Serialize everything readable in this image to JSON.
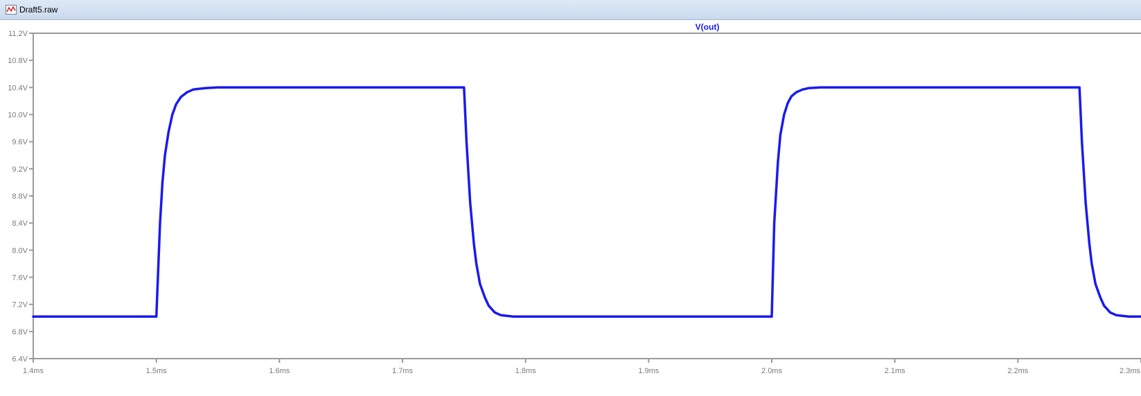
{
  "window": {
    "title": "Draft5.raw",
    "icon": "waveform-icon"
  },
  "colors": {
    "trace": "#1a1aef",
    "axis": "#9a9a9a",
    "tick_label": "#7a7a7a",
    "title_bar": "#d4e1f2"
  },
  "chart_data": {
    "type": "line",
    "title": "V(out)",
    "xlabel": "",
    "ylabel": "",
    "xlim": [
      1.4,
      2.3
    ],
    "ylim": [
      6.4,
      11.2
    ],
    "x_ticks": [
      1.4,
      1.5,
      1.6,
      1.7,
      1.8,
      1.9,
      2.0,
      2.1,
      2.2,
      2.3
    ],
    "x_tick_labels": [
      "1.4ms",
      "1.5ms",
      "1.6ms",
      "1.7ms",
      "1.8ms",
      "1.9ms",
      "2.0ms",
      "2.1ms",
      "2.2ms",
      "2.3ms"
    ],
    "y_ticks": [
      6.4,
      6.8,
      7.2,
      7.6,
      8.0,
      8.4,
      8.8,
      9.2,
      9.6,
      10.0,
      10.4,
      10.8,
      11.2
    ],
    "y_tick_labels": [
      "6.4V",
      "6.8V",
      "7.2V",
      "7.6V",
      "8.0V",
      "8.4V",
      "8.8V",
      "9.2V",
      "9.6V",
      "10.0V",
      "10.4V",
      "10.8V",
      "11.2V"
    ],
    "grid": false,
    "series": [
      {
        "name": "V(out)",
        "x": [
          1.4,
          1.5,
          1.503,
          1.505,
          1.507,
          1.51,
          1.513,
          1.516,
          1.52,
          1.525,
          1.53,
          1.54,
          1.55,
          1.6,
          1.7,
          1.75,
          1.752,
          1.755,
          1.758,
          1.76,
          1.763,
          1.767,
          1.77,
          1.775,
          1.78,
          1.79,
          1.8,
          1.9,
          2.0,
          2.002,
          2.005,
          2.007,
          2.01,
          2.013,
          2.016,
          2.02,
          2.025,
          2.03,
          2.04,
          2.05,
          2.1,
          2.2,
          2.25,
          2.252,
          2.255,
          2.258,
          2.26,
          2.263,
          2.267,
          2.27,
          2.275,
          2.28,
          2.29,
          2.3
        ],
        "y": [
          7.02,
          7.02,
          8.4,
          9.0,
          9.4,
          9.75,
          10.0,
          10.15,
          10.26,
          10.33,
          10.37,
          10.39,
          10.4,
          10.4,
          10.4,
          10.4,
          9.6,
          8.7,
          8.1,
          7.8,
          7.5,
          7.3,
          7.18,
          7.08,
          7.04,
          7.02,
          7.02,
          7.02,
          7.02,
          8.4,
          9.3,
          9.7,
          10.0,
          10.17,
          10.27,
          10.33,
          10.37,
          10.39,
          10.4,
          10.4,
          10.4,
          10.4,
          10.4,
          9.6,
          8.7,
          8.1,
          7.8,
          7.5,
          7.3,
          7.18,
          7.08,
          7.04,
          7.02,
          7.02
        ]
      }
    ]
  }
}
